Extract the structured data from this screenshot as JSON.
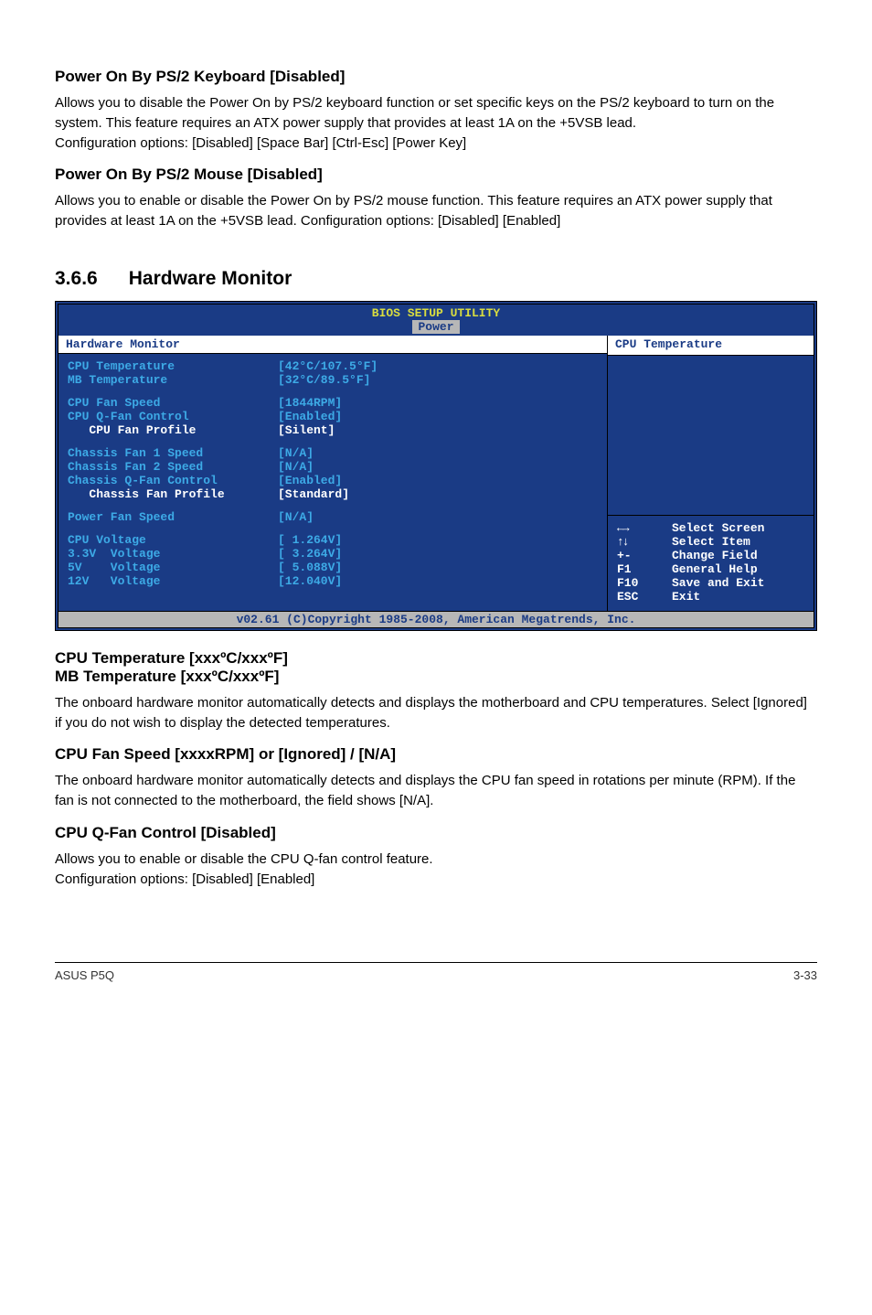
{
  "s1": {
    "heading": "Power On By PS/2 Keyboard [Disabled]",
    "text": "Allows you to disable the Power On by PS/2 keyboard function or set specific keys on the PS/2 keyboard to turn on the system. This feature requires an ATX power supply that provides at least 1A on the +5VSB lead.\nConfiguration options: [Disabled] [Space Bar] [Ctrl-Esc] [Power Key]"
  },
  "s2": {
    "heading": "Power On By PS/2 Mouse [Disabled]",
    "text": "Allows you to enable or disable the Power On by PS/2 mouse function. This feature requires an ATX power supply that provides at least 1A on the +5VSB lead. Configuration options: [Disabled] [Enabled]"
  },
  "h2": {
    "number": "3.6.6",
    "title": "Hardware Monitor"
  },
  "bios": {
    "title": "BIOS SETUP UTILITY",
    "tab": "Power",
    "left_header": "Hardware Monitor",
    "right_header": "CPU Temperature",
    "rows": [
      {
        "label": "CPU Temperature",
        "value": "[42°C/107.5°F]",
        "indent": 0
      },
      {
        "label": "MB Temperature",
        "value": "[32°C/89.5°F]",
        "indent": 0
      },
      {
        "gap": true
      },
      {
        "label": "CPU Fan Speed",
        "value": "[1844RPM]",
        "indent": 0
      },
      {
        "label": "CPU Q-Fan Control",
        "value": "[Enabled]",
        "indent": 0
      },
      {
        "label": "CPU Fan Profile",
        "value": "[Silent]",
        "indent": 1,
        "white": true
      },
      {
        "gap": true
      },
      {
        "label": "Chassis Fan 1 Speed",
        "value": "[N/A]",
        "indent": 0
      },
      {
        "label": "Chassis Fan 2 Speed",
        "value": "[N/A]",
        "indent": 0
      },
      {
        "label": "Chassis Q-Fan Control",
        "value": "[Enabled]",
        "indent": 0
      },
      {
        "label": "Chassis Fan Profile",
        "value": "[Standard]",
        "indent": 1,
        "white": true
      },
      {
        "gap": true
      },
      {
        "label": "Power Fan Speed",
        "value": "[N/A]",
        "indent": 0
      },
      {
        "gap": true
      },
      {
        "label": "CPU Voltage",
        "value": "[ 1.264V]",
        "indent": 0
      },
      {
        "label": "3.3V  Voltage",
        "value": "[ 3.264V]",
        "indent": 0
      },
      {
        "label": "5V    Voltage",
        "value": "[ 5.088V]",
        "indent": 0
      },
      {
        "label": "12V   Voltage",
        "value": "[12.040V]",
        "indent": 0
      }
    ],
    "help": [
      {
        "key": "lr",
        "text": "Select Screen"
      },
      {
        "key": "ud",
        "text": "Select Item"
      },
      {
        "key": "+-",
        "text": "Change Field"
      },
      {
        "key": "F1",
        "text": "General Help"
      },
      {
        "key": "F10",
        "text": "Save and Exit"
      },
      {
        "key": "ESC",
        "text": "Exit"
      }
    ],
    "bottom": "v02.61 (C)Copyright 1985-2008, American Megatrends, Inc."
  },
  "s3": {
    "heading_a": "CPU Temperature [xxxºC/xxxºF]",
    "heading_b": "MB Temperature [xxxºC/xxxºF]",
    "text": "The onboard hardware monitor automatically detects and displays the motherboard and CPU temperatures. Select [Ignored] if you do not wish to display the detected temperatures."
  },
  "s4": {
    "heading": "CPU Fan Speed [xxxxRPM] or [Ignored] / [N/A]",
    "text": "The onboard hardware monitor automatically detects and displays the CPU fan speed in rotations per minute (RPM). If the fan is not connected to the motherboard, the field shows [N/A]."
  },
  "s5": {
    "heading": "CPU Q-Fan Control [Disabled]",
    "text": "Allows you to enable or disable the CPU Q-fan control feature.\nConfiguration options: [Disabled] [Enabled]"
  },
  "footer": {
    "left": "ASUS P5Q",
    "right": "3-33"
  }
}
